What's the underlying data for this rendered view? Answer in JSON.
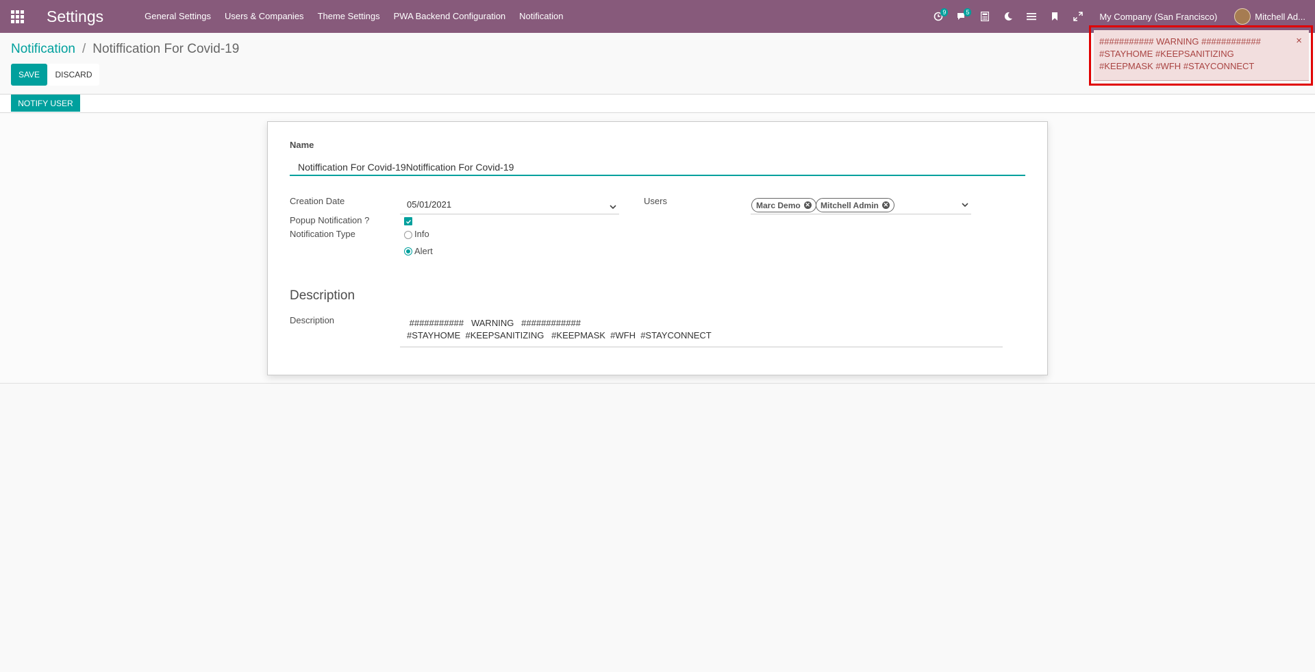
{
  "navbar": {
    "brand": "Settings",
    "menu": [
      "General Settings",
      "Users & Companies",
      "Theme Settings",
      "PWA Backend Configuration",
      "Notification"
    ],
    "activity_count": "9",
    "messages_count": "5",
    "company": "My Company (San Francisco)",
    "user": "Mitchell Ad..."
  },
  "breadcrumb": {
    "parent": "Notification",
    "separator": "/",
    "current": "Notiffication For Covid-19"
  },
  "buttons": {
    "save": "SAVE",
    "discard": "DISCARD",
    "notify_user": "NOTIFY USER"
  },
  "form": {
    "name_label": "Name",
    "name_value": "Notiffication For Covid-19Notiffication For Covid-19",
    "creation_date_label": "Creation Date",
    "creation_date_value": "05/01/2021",
    "users_label": "Users",
    "users": [
      "Marc Demo",
      "Mitchell Admin"
    ],
    "popup_label": "Popup Notification ?",
    "popup_checked": true,
    "type_label": "Notification Type",
    "type_options": [
      "Info",
      "Alert"
    ],
    "type_selected": "Alert",
    "section_title": "Description",
    "description_label": "Description",
    "description_line1": " ###########   WARNING   ############",
    "description_line2": "#STAYHOME  #KEEPSANITIZING   #KEEPMASK  #WFH  #STAYCONNECT"
  },
  "toast": {
    "line1": "########### WARNING ############",
    "line2": "#STAYHOME #KEEPSANITIZING",
    "line3": "#KEEPMASK #WFH #STAYCONNECT",
    "close": "×"
  },
  "colors": {
    "navbar": "#875a7b",
    "primary": "#00a09d",
    "toast_bg": "#f2dede",
    "toast_text": "#a94442",
    "highlight": "#e00000"
  }
}
